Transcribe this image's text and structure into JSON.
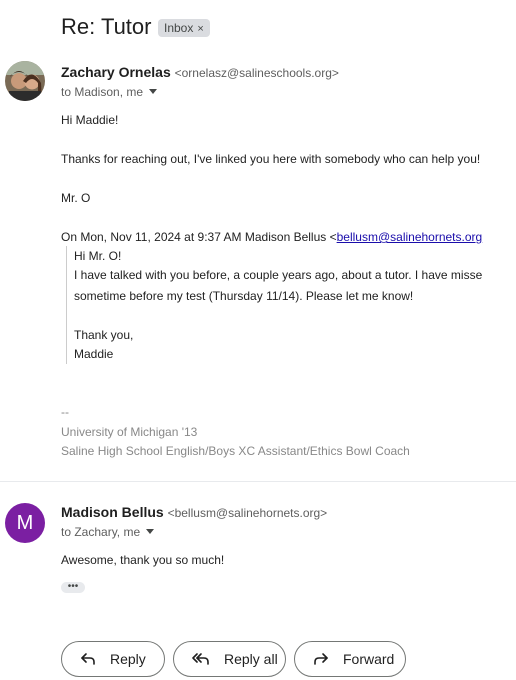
{
  "subject": "Re: Tutor",
  "label_badge": {
    "text": "Inbox",
    "close": "×"
  },
  "messages": [
    {
      "sender_name": "Zachary Ornelas",
      "sender_email": "<ornelasz@salineschools.org>",
      "to": "to Madison, me",
      "body": [
        "Hi Maddie!",
        "Thanks for reaching out, I've linked you here with somebody who can help you!",
        "Mr. O"
      ],
      "quote_header_prefix": "On Mon, Nov 11, 2024 at 9:37 AM Madison Bellus <",
      "quote_header_link": "bellusm@salinehornets.org",
      "quote": [
        "Hi Mr. O!",
        "I have talked with you before, a couple years ago, about a tutor. I have misse",
        "sometime before my test (Thursday 11/14). Please let me know!",
        "Thank you,",
        "Maddie"
      ],
      "signature": [
        "--",
        "University of Michigan '13",
        "Saline High School English/Boys XC Assistant/Ethics Bowl Coach"
      ]
    },
    {
      "avatar_letter": "M",
      "avatar_color": "#7b1fa2",
      "sender_name": "Madison Bellus",
      "sender_email": "<bellusm@salinehornets.org>",
      "to": "to Zachary, me",
      "body": [
        "Awesome, thank you so much!"
      ],
      "more": "•••"
    }
  ],
  "actions": {
    "reply": "Reply",
    "reply_all": "Reply all",
    "forward": "Forward"
  }
}
